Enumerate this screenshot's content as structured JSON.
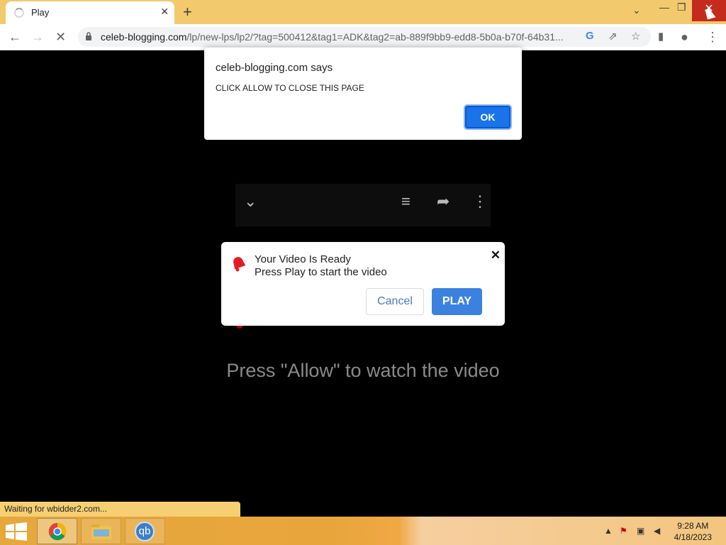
{
  "browser": {
    "tab": {
      "title": "Play",
      "close_glyph": "✕"
    },
    "new_tab_glyph": "+",
    "window_controls": {
      "tab_search": "⌄",
      "minimize": "—",
      "restore": "❐",
      "close": "✕"
    },
    "url_host": "celeb-blogging.com",
    "url_rest": "/lp/new-lps/lp2/?tag=500412&tag1=ADK&tag2=ab-889f9bb9-edd8-5b0a-b70f-64b31...",
    "nav": {
      "back": "←",
      "forward": "→",
      "stop": "✕"
    }
  },
  "alert": {
    "title": "celeb-blogging.com says",
    "message": "CLICK ALLOW TO CLOSE THIS PAGE",
    "ok_label": "OK"
  },
  "modal": {
    "title": "Your Video Is Ready",
    "subtitle": "Press Play to start the video",
    "close_glyph": "✕",
    "cancel_label": "Cancel",
    "play_label": "PLAY"
  },
  "page": {
    "press_allow": "Press \"Allow\" to watch the video"
  },
  "status": {
    "text": "Waiting for wbidder2.com..."
  },
  "taskbar": {
    "apps": [
      "Google Chrome",
      "File Explorer",
      "qBittorrent"
    ],
    "qb_label": "qb",
    "time": "9:28 AM",
    "date": "4/18/2023"
  },
  "colors": {
    "titlebar": "#f2c96d",
    "accent_blue": "#1a73e8",
    "play_blue": "#3b82e0",
    "close_red": "#c42b1c"
  }
}
